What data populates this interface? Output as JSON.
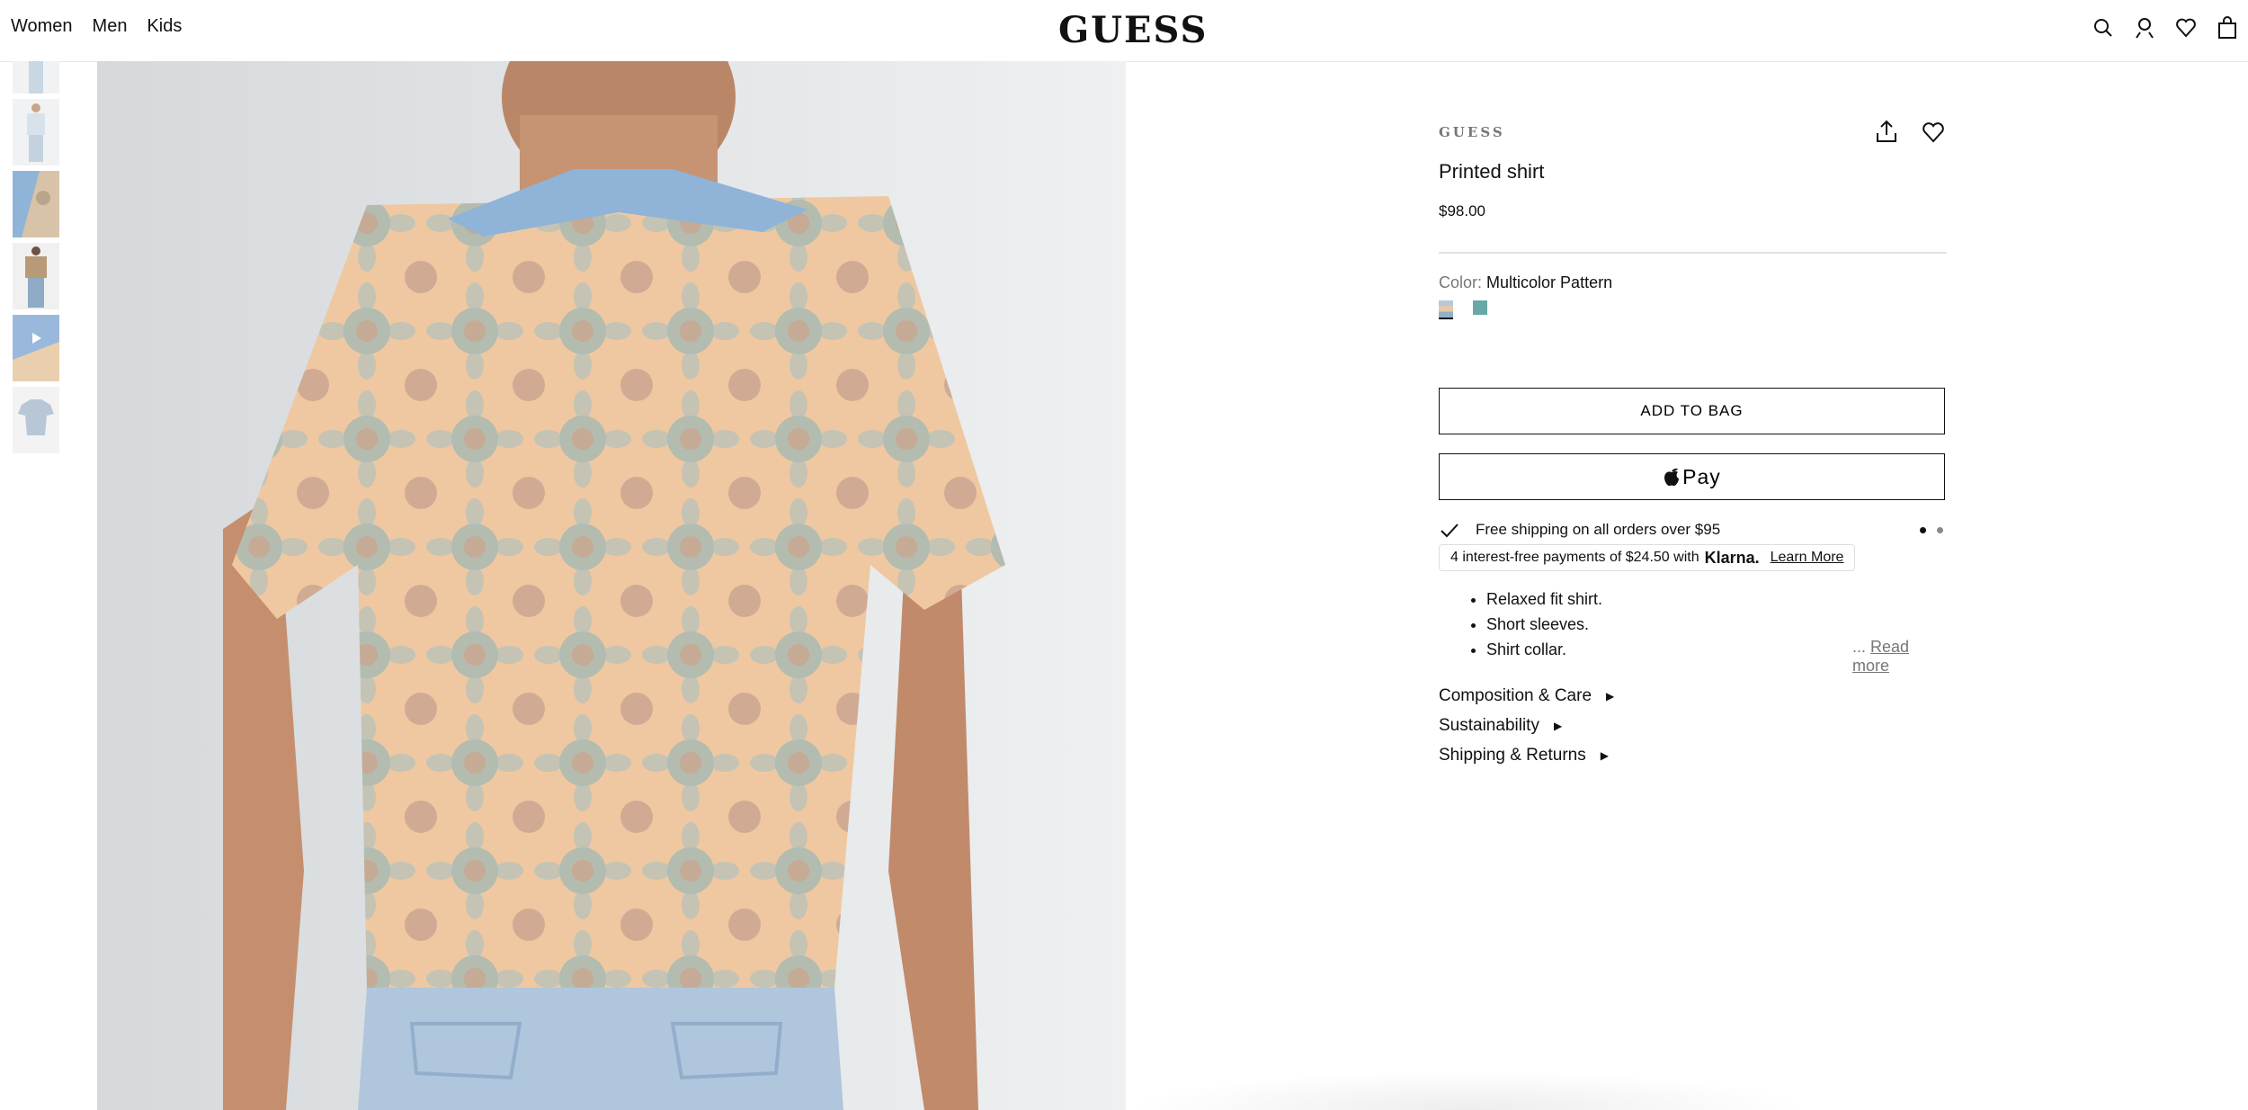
{
  "nav": {
    "items": [
      "Women",
      "Men",
      "Kids"
    ]
  },
  "brand_logo": "GUESS",
  "header_icons": [
    "search-icon",
    "account-icon",
    "heart-icon",
    "bag-icon"
  ],
  "thumbnails": [
    "thumb-front-full",
    "thumb-front",
    "thumb-detail",
    "thumb-back",
    "thumb-pattern-closeup",
    "thumb-flat"
  ],
  "product": {
    "brand": "GUESS",
    "title": "Printed shirt",
    "price": "$98.00",
    "color_label": "Color:",
    "color_value": "Multicolor Pattern",
    "swatch_colors": [
      "#b7c9d9",
      "#6aa7a8"
    ],
    "add_to_bag": "ADD TO BAG",
    "apple_pay": "Pay",
    "shipping_message": "Free shipping on all orders over $95",
    "klarna": {
      "prefix": "4 interest-free payments of $24.50 with",
      "brand": "Klarna.",
      "link": "Learn More"
    },
    "features": [
      "Relaxed fit shirt.",
      "Short sleeves.",
      "Shirt collar."
    ],
    "read_more_prefix": "...",
    "read_more": "Read more",
    "accordions": [
      "Composition & Care",
      "Sustainability",
      "Shipping & Returns"
    ]
  }
}
